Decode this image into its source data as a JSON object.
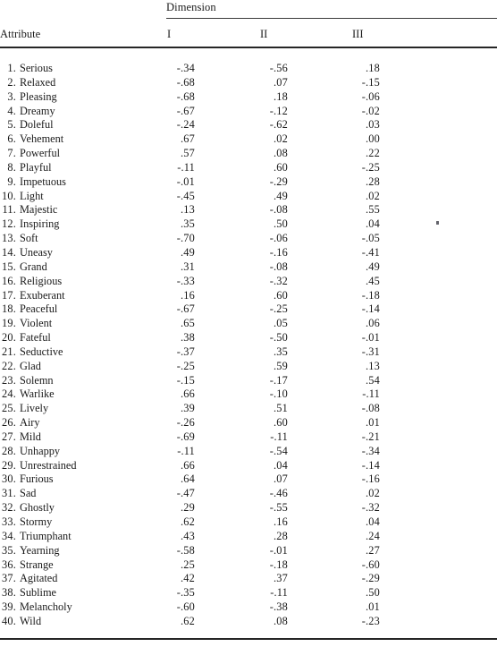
{
  "table": {
    "spanner_label": "Dimension",
    "row_header_label": "Attribute",
    "columns": [
      "I",
      "II",
      "III"
    ],
    "rows": [
      {
        "index": "1.",
        "label": "Serious",
        "values": [
          "-.34",
          "-.56",
          ".18"
        ]
      },
      {
        "index": "2.",
        "label": "Relaxed",
        "values": [
          "-.68",
          ".07",
          "-.15"
        ]
      },
      {
        "index": "3.",
        "label": "Pleasing",
        "values": [
          "-.68",
          ".18",
          "-.06"
        ]
      },
      {
        "index": "4.",
        "label": "Dreamy",
        "values": [
          "-.67",
          "-.12",
          "-.02"
        ]
      },
      {
        "index": "5.",
        "label": "Doleful",
        "values": [
          "-.24",
          "-.62",
          ".03"
        ]
      },
      {
        "index": "6.",
        "label": "Vehement",
        "values": [
          ".67",
          ".02",
          ".00"
        ]
      },
      {
        "index": "7.",
        "label": "Powerful",
        "values": [
          ".57",
          ".08",
          ".22"
        ]
      },
      {
        "index": "8.",
        "label": "Playful",
        "values": [
          "-.11",
          ".60",
          "-.25"
        ]
      },
      {
        "index": "9.",
        "label": "Impetuous",
        "values": [
          "-.01",
          "-.29",
          ".28"
        ]
      },
      {
        "index": "10.",
        "label": "Light",
        "values": [
          "-.45",
          ".49",
          ".02"
        ]
      },
      {
        "index": "11.",
        "label": "Majestic",
        "values": [
          ".13",
          "-.08",
          ".55"
        ]
      },
      {
        "index": "12.",
        "label": "Inspiring",
        "values": [
          ".35",
          ".50",
          ".04"
        ]
      },
      {
        "index": "13.",
        "label": "Soft",
        "values": [
          "-.70",
          "-.06",
          "-.05"
        ]
      },
      {
        "index": "14.",
        "label": "Uneasy",
        "values": [
          ".49",
          "-.16",
          "-.41"
        ]
      },
      {
        "index": "15.",
        "label": "Grand",
        "values": [
          ".31",
          "-.08",
          ".49"
        ]
      },
      {
        "index": "16.",
        "label": "Religious",
        "values": [
          "-.33",
          "-.32",
          ".45"
        ]
      },
      {
        "index": "17.",
        "label": "Exuberant",
        "values": [
          ".16",
          ".60",
          "-.18"
        ]
      },
      {
        "index": "18.",
        "label": "Peaceful",
        "values": [
          "-.67",
          "-.25",
          "-.14"
        ]
      },
      {
        "index": "19.",
        "label": "Violent",
        "values": [
          ".65",
          ".05",
          ".06"
        ]
      },
      {
        "index": "20.",
        "label": "Fateful",
        "values": [
          ".38",
          "-.50",
          "-.01"
        ]
      },
      {
        "index": "21.",
        "label": "Seductive",
        "values": [
          "-.37",
          ".35",
          "-.31"
        ]
      },
      {
        "index": "22.",
        "label": "Glad",
        "values": [
          "-.25",
          ".59",
          ".13"
        ]
      },
      {
        "index": "23.",
        "label": "Solemn",
        "values": [
          "-.15",
          "-.17",
          ".54"
        ]
      },
      {
        "index": "24.",
        "label": "Warlike",
        "values": [
          ".66",
          "-.10",
          "-.11"
        ]
      },
      {
        "index": "25.",
        "label": "Lively",
        "values": [
          ".39",
          ".51",
          "-.08"
        ]
      },
      {
        "index": "26.",
        "label": "Airy",
        "values": [
          "-.26",
          ".60",
          ".01"
        ]
      },
      {
        "index": "27.",
        "label": "Mild",
        "values": [
          "-.69",
          "-.11",
          "-.21"
        ]
      },
      {
        "index": "28.",
        "label": "Unhappy",
        "values": [
          "-.11",
          "-.54",
          "-.34"
        ]
      },
      {
        "index": "29.",
        "label": "Unrestrained",
        "values": [
          ".66",
          ".04",
          "-.14"
        ]
      },
      {
        "index": "30.",
        "label": "Furious",
        "values": [
          ".64",
          ".07",
          "-.16"
        ]
      },
      {
        "index": "31.",
        "label": "Sad",
        "values": [
          "-.47",
          "-.46",
          ".02"
        ]
      },
      {
        "index": "32.",
        "label": "Ghostly",
        "values": [
          ".29",
          "-.55",
          "-.32"
        ]
      },
      {
        "index": "33.",
        "label": "Stormy",
        "values": [
          ".62",
          ".16",
          ".04"
        ]
      },
      {
        "index": "34.",
        "label": "Triumphant",
        "values": [
          ".43",
          ".28",
          ".24"
        ]
      },
      {
        "index": "35.",
        "label": "Yearning",
        "values": [
          "-.58",
          "-.01",
          ".27"
        ]
      },
      {
        "index": "36.",
        "label": "Strange",
        "values": [
          ".25",
          "-.18",
          "-.60"
        ]
      },
      {
        "index": "37.",
        "label": "Agitated",
        "values": [
          ".42",
          ".37",
          "-.29"
        ]
      },
      {
        "index": "38.",
        "label": "Sublime",
        "values": [
          "-.35",
          "-.11",
          ".50"
        ]
      },
      {
        "index": "39.",
        "label": "Melancholy",
        "values": [
          "-.60",
          "-.38",
          ".01"
        ]
      },
      {
        "index": "40.",
        "label": "Wild",
        "values": [
          ".62",
          ".08",
          "-.23"
        ]
      }
    ]
  }
}
